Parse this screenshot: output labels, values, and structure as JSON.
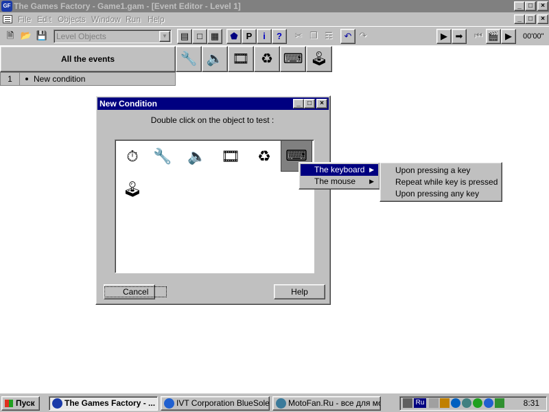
{
  "window": {
    "title": "The Games Factory - Game1.gam - [Event Editor - Level 1]",
    "app_icon_label": "GF"
  },
  "menubar": {
    "items": [
      "File",
      "Edit",
      "Objects",
      "Window",
      "Run",
      "Help"
    ]
  },
  "toolbar": {
    "combo_value": "Level Objects",
    "timecode": "00'00\""
  },
  "event_editor": {
    "header_label": "All the events",
    "object_icons": [
      "wrench-icon",
      "speaker-icon",
      "film-icon",
      "storyboard-controls-icon",
      "keyboard-mouse-icon",
      "player-1-joystick-icon"
    ],
    "rows": [
      {
        "number": "1",
        "label": "New condition"
      }
    ]
  },
  "dialog": {
    "title": "New Condition",
    "instruction": "Double click on the object to test :",
    "objects": [
      "timer-icon",
      "wrench-icon",
      "speaker-icon",
      "film-icon",
      "storyboard-controls-icon",
      "keyboard-mouse-icon",
      "player-1-joystick-icon"
    ],
    "selected_object": "keyboard-mouse-icon",
    "cancel_label": "Cancel",
    "help_label": "Help"
  },
  "context_menu": {
    "items": [
      {
        "label": "The keyboard",
        "highlighted": true
      },
      {
        "label": "The mouse",
        "highlighted": false
      }
    ]
  },
  "submenu": {
    "items": [
      "Upon pressing a key",
      "Repeat while key is pressed",
      "Upon pressing any key"
    ]
  },
  "taskbar": {
    "start_label": "Пуск",
    "tasks": [
      {
        "label": "The Games Factory - ...",
        "active": true
      },
      {
        "label": "IVT Corporation BlueSoleil ...",
        "active": false
      },
      {
        "label": "MotoFan.Ru - все для мо...",
        "active": false
      }
    ],
    "language": "Ru",
    "clock": "8:31"
  },
  "colors": {
    "titlebar_inactive": "#808080",
    "dialog_title_active": "#000080",
    "menu_highlight": "#000080",
    "face": "#c0c0c0"
  }
}
